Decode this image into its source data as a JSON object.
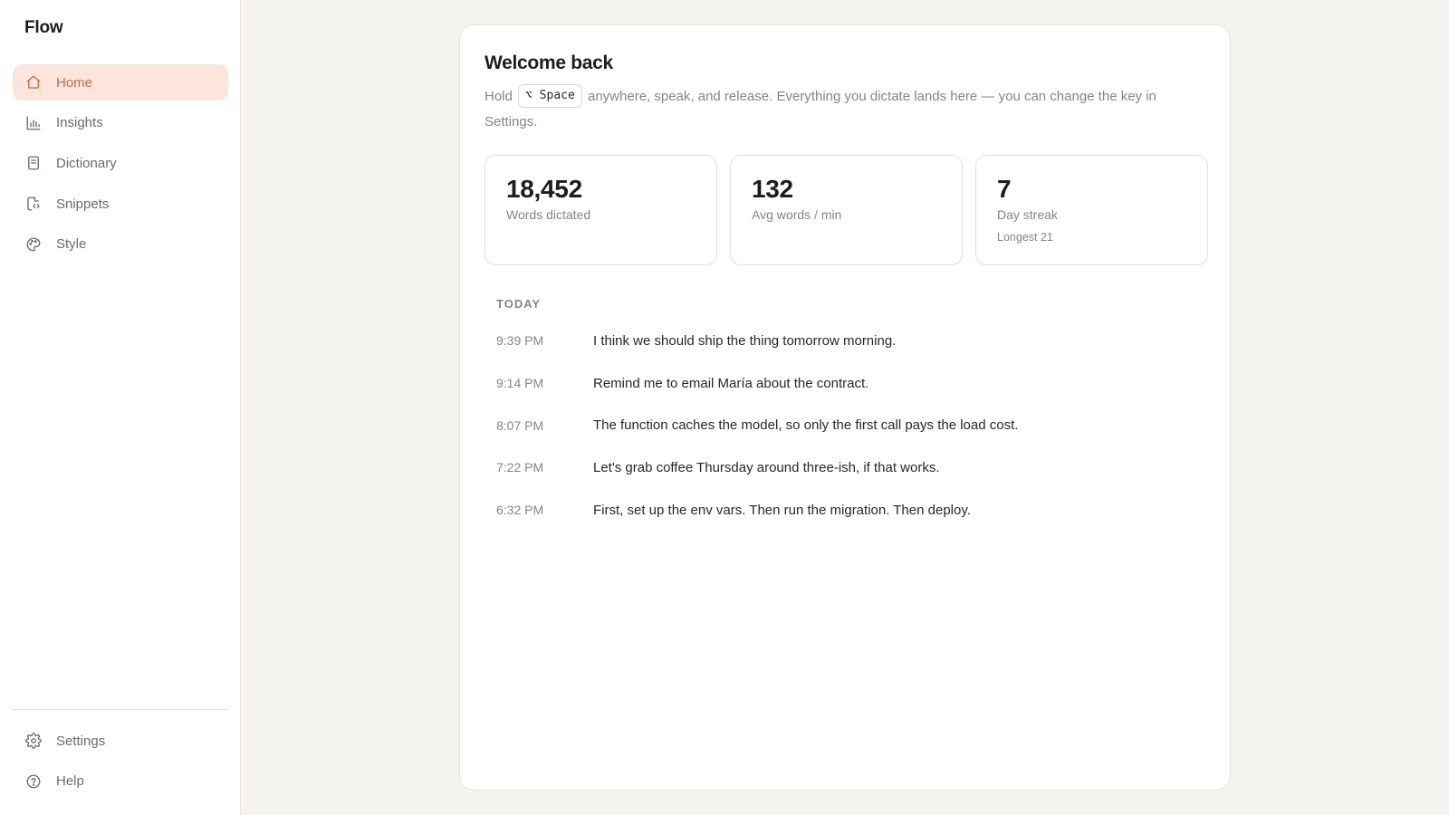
{
  "app": {
    "name": "Flow"
  },
  "sidebar": {
    "items": [
      {
        "label": "Home",
        "icon": "home-icon",
        "active": true
      },
      {
        "label": "Insights",
        "icon": "bar-chart-icon",
        "active": false
      },
      {
        "label": "Dictionary",
        "icon": "book-icon",
        "active": false
      },
      {
        "label": "Snippets",
        "icon": "code-file-icon",
        "active": false
      },
      {
        "label": "Style",
        "icon": "palette-icon",
        "active": false
      }
    ],
    "bottom_items": [
      {
        "label": "Settings",
        "icon": "gear-icon"
      },
      {
        "label": "Help",
        "icon": "help-circle-icon"
      }
    ]
  },
  "main": {
    "title": "Welcome back",
    "intro": {
      "before": "Hold",
      "key": "⌥ Space",
      "after": "anywhere, speak, and release. Everything you dictate lands here — you can change the key in Settings."
    },
    "stats": [
      {
        "value": "18,452",
        "label": "Words dictated",
        "sub": ""
      },
      {
        "value": "132",
        "label": "Avg words / min",
        "sub": ""
      },
      {
        "value": "7",
        "label": "Day streak",
        "sub": "Longest 21"
      }
    ],
    "section_label": "TODAY",
    "entries": [
      {
        "time": "9:39 PM",
        "text": "I think we should ship the thing tomorrow morning."
      },
      {
        "time": "9:14 PM",
        "text": "Remind me to email María about the contract."
      },
      {
        "time": "8:07 PM",
        "text": "The function caches the model, so only the first call pays the load cost."
      },
      {
        "time": "7:22 PM",
        "text": "Let's grab coffee Thursday around three-ish, if that works."
      },
      {
        "time": "6:32 PM",
        "text": "First, set up the env vars. Then run the migration. Then deploy."
      }
    ]
  },
  "colors": {
    "accent": "#c8694a",
    "accent_bg": "#fbe5dc",
    "page_bg": "#f6f4f1",
    "muted_text": "#8a847e"
  }
}
